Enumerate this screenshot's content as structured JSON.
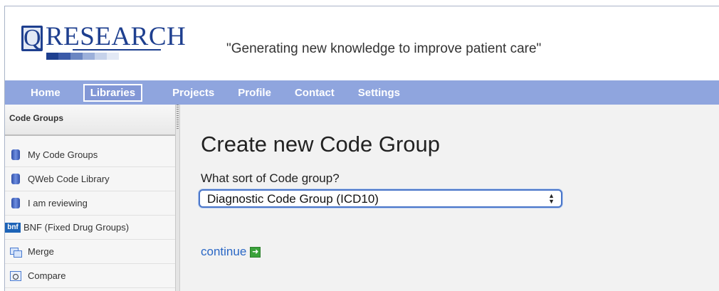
{
  "header": {
    "logo_q": "Q",
    "logo_text": "RESEARCH",
    "tagline": "\"Generating new knowledge to improve patient care\"",
    "logo_bar_colors": [
      "#1e3f8f",
      "#3b5aa8",
      "#6b86c2",
      "#9cb0da",
      "#c6d2ea",
      "#e3e9f5"
    ]
  },
  "nav": {
    "items": [
      {
        "label": "Home"
      },
      {
        "label": "Libraries"
      },
      {
        "label": "Projects"
      },
      {
        "label": "Profile"
      },
      {
        "label": "Contact"
      },
      {
        "label": "Settings"
      }
    ],
    "active": "Libraries"
  },
  "sidebar": {
    "header": "Code Groups",
    "items": [
      {
        "label": "My Code Groups",
        "icon": "database-icon"
      },
      {
        "label": "QWeb Code Library",
        "icon": "database-icon"
      },
      {
        "label": "I am reviewing",
        "icon": "database-icon"
      },
      {
        "label": "BNF (Fixed Drug Groups)",
        "icon": "bnf-icon",
        "icon_text": "bnf"
      },
      {
        "label": "Merge",
        "icon": "merge-icon"
      },
      {
        "label": "Compare",
        "icon": "compare-icon"
      }
    ]
  },
  "main": {
    "title": "Create new Code Group",
    "question": "What sort of Code group?",
    "select_value": "Diagnostic Code Group (ICD10)",
    "continue_label": "continue"
  },
  "colors": {
    "nav_bg": "#8fa5de",
    "brand": "#1e3f8f",
    "link": "#2a67c5"
  }
}
